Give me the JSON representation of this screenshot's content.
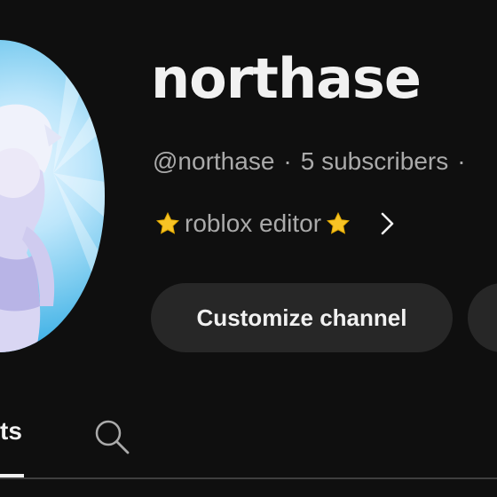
{
  "channel": {
    "name": "northase",
    "handle": "@northase",
    "subscribers": "5 subscribers",
    "separator": "·",
    "description": "roblox editor"
  },
  "buttons": {
    "customize_label": "Customize channel"
  },
  "tabs": {
    "active_partial_label": "ts"
  },
  "icons": {
    "avatar": "avatar-image",
    "star": "star-icon",
    "chevron": "chevron-right-icon",
    "search": "search-icon"
  },
  "colors": {
    "background": "#0f0f0f",
    "button_bg": "#272727",
    "text_primary": "#f1f1f1",
    "text_secondary": "#aaaaaa",
    "star": "#f7c325"
  }
}
